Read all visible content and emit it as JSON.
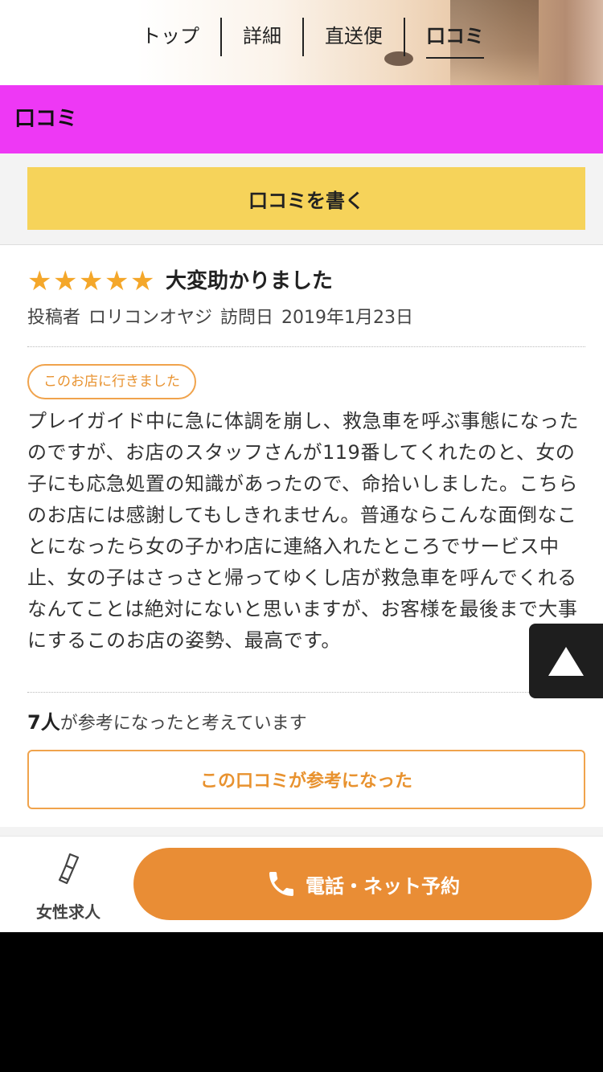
{
  "nav": {
    "items": [
      {
        "label": "トップ"
      },
      {
        "label": "詳細"
      },
      {
        "label": "直送便"
      },
      {
        "label": "口コミ"
      }
    ]
  },
  "section": {
    "title": "口コミ"
  },
  "write_button": {
    "label": "口コミを書く"
  },
  "review": {
    "rating": 5,
    "title": "大変助かりました",
    "poster_label": "投稿者",
    "poster_name": "ロリコンオヤジ",
    "visit_label": "訪問日",
    "visit_date": "2019年1月23日",
    "visited_badge": "このお店に行きました",
    "body": "プレイガイド中に急に体調を崩し、救急車を呼ぶ事態になったのですが、お店のスタッフさんが119番してくれたのと、女の子にも応急処置の知識があったので、命拾いしました。こちらのお店には感謝してもしきれません。普通ならこんな面倒なことになったら女の子かわ店に連絡入れたところでサービス中止、女の子はさっさと帰ってゆくし店が救急車を呼んでくれるなんてことは絶対にないと思いますが、お客様を最後まで大事にするこのお店の姿勢、最高です。",
    "helpful_count": "7人",
    "helpful_text": "が参考になったと考えています",
    "helpful_button": "この口コミが参考になった"
  },
  "bottom": {
    "jobs_label": "女性求人",
    "reserve_label": "電話・ネット予約"
  },
  "colors": {
    "section_bar": "#ee38f5",
    "write_button": "#f6d35a",
    "accent_orange": "#e98d35",
    "star": "#f4a72a"
  },
  "icons": [
    "star-icon",
    "lipstick-icon",
    "phone-icon",
    "scroll-top-icon"
  ]
}
